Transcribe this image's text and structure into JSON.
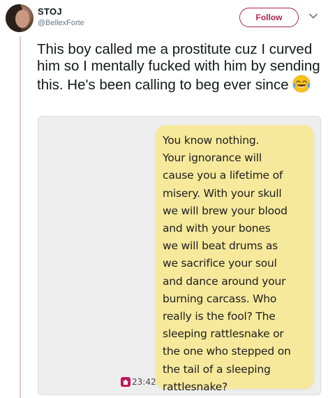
{
  "tweet": {
    "display_name": "STOJ",
    "handle": "@BellexForte",
    "follow_label": "Follow",
    "text": "This boy called me a prostitute cuz I curved him so I mentally fucked with him by sending this. He's been calling to beg ever since",
    "emoji": "face-with-tears-of-joy-icon"
  },
  "media": {
    "message": "You know nothing.\nYour ignorance will\ncause you a lifetime of\nmisery. With your skull\nwe will brew your blood\nand with your bones\nwe will beat drums as\nwe sacrifice your soul\nand dance around your\nburning carcass. Who\nreally is the fool? The\nsleeping rattlesnake or\nthe one who stepped on\nthe tail of a sleeping\nrattlesnake?",
    "time": "23:42"
  },
  "colors": {
    "accent": "#b2224f",
    "bubble": "#f7e99c",
    "thread_line": "#e1c9d8"
  }
}
